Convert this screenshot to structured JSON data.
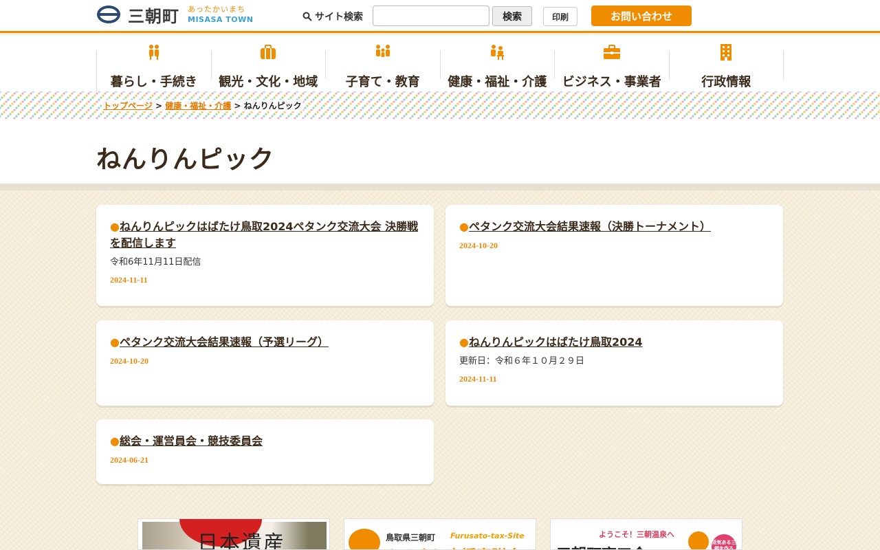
{
  "header": {
    "logo_text": "三朝町",
    "logo_sub_ja": "あったかいまち",
    "logo_sub_en": "MISASA TOWN",
    "search_label": "サイト検索",
    "search_placeholder": "",
    "search_button": "検索",
    "print_button": "印刷",
    "contact_button": "お問い合わせ"
  },
  "nav": {
    "items": [
      {
        "label": "暮らし・手続き",
        "icon": "family-icon"
      },
      {
        "label": "観光・文化・地域",
        "icon": "suitcase-icon"
      },
      {
        "label": "子育て・教育",
        "icon": "parent-child-icon"
      },
      {
        "label": "健康・福祉・介護",
        "icon": "care-icon"
      },
      {
        "label": "ビジネス・事業者",
        "icon": "briefcase-icon"
      },
      {
        "label": "行政情報",
        "icon": "building-icon"
      }
    ]
  },
  "breadcrumb": {
    "home": "トップページ",
    "parent": "健康・福祉・介護",
    "current": "ねんりんピック",
    "sep": ">"
  },
  "page": {
    "title": "ねんりんピック"
  },
  "cards": [
    {
      "bullet": "●",
      "title": "ねんりんピックはばたけ鳥取2024ペタンク交流大会 決勝戦を配信します",
      "desc": "令和6年11月11日配信",
      "date": "2024-11-11"
    },
    {
      "bullet": "●",
      "title": "ペタンク交流大会結果速報（決勝トーナメント）",
      "desc": "",
      "date": "2024-10-20"
    },
    {
      "bullet": "●",
      "title": "ペタンク交流大会結果速報（予選リーグ）",
      "desc": "",
      "date": "2024-10-20"
    },
    {
      "bullet": "●",
      "title": "ねんりんピックはばたけ鳥取2024",
      "desc": "更新日：令和６年１０月２９日",
      "date": "2024-11-11"
    },
    {
      "bullet": "●",
      "title": "総会・運営員会・競技委員会",
      "desc": "",
      "date": "2024-06-21"
    }
  ],
  "banners": {
    "b1_text": "日本遺産",
    "b2_sub": "鳥取県三朝町",
    "b2_sub2": "Furusato-tax-Site",
    "b2_big": "ふるさと応援寄附金",
    "b3_sub": "ようこそ！三朝温泉へ",
    "b3_big": "三朝町商工会",
    "b3_badge": "活気ある三朝を作ろう!"
  },
  "colors": {
    "accent": "#f08c00",
    "title_text": "#3a2a1a",
    "date": "#e8870a",
    "content_bg": "#f6eedb"
  }
}
